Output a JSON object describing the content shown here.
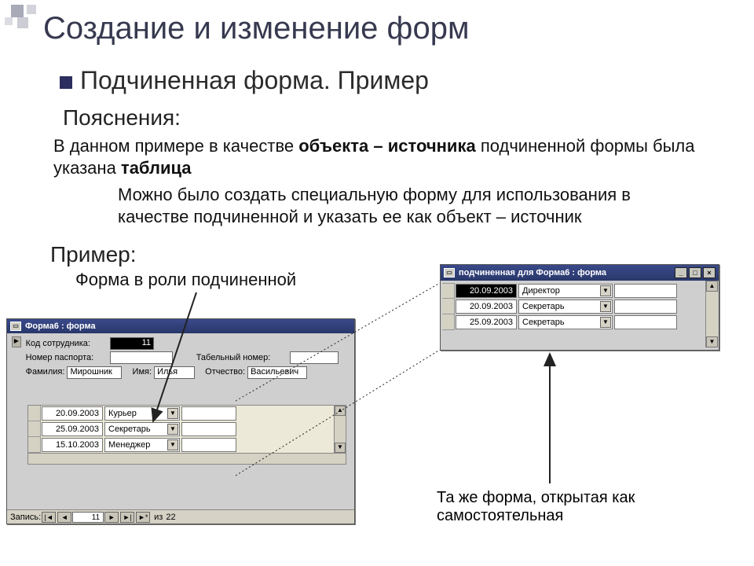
{
  "slide": {
    "title": "Создание и изменение форм",
    "subtitle": "Подчиненная форма. Пример",
    "expl_head": "Пояснения:",
    "para1_a": "В данном примере в качестве ",
    "para1_b": "объекта – источника",
    "para1_c": " подчиненной формы была указана ",
    "para1_d": "таблица",
    "para2": "Можно было создать специальную форму для использования в качестве подчиненной и указать ее как объект – источник",
    "example_head": "Пример:",
    "caption_role": "Форма в роли подчиненной",
    "caption_same": "Та же форма, открытая как самостоятельная"
  },
  "window_main": {
    "title": "Форма6 : форма",
    "labels": {
      "code": "Код сотрудника:",
      "passport": "Номер паспорта:",
      "tab": "Табельный номер:",
      "fam": "Фамилия:",
      "name": "Имя:",
      "patr": "Отчество:"
    },
    "values": {
      "code": "11",
      "passport": "",
      "tab": "",
      "fam": "Мирошник",
      "name": "Илья",
      "patr": "Васильевич"
    },
    "rows": [
      {
        "date": "20.09.2003",
        "job": "Курьер"
      },
      {
        "date": "25.09.2003",
        "job": "Секретарь"
      },
      {
        "date": "15.10.2003",
        "job": "Менеджер"
      }
    ],
    "nav": {
      "record_label": "Запись:",
      "current": "11",
      "of": "из",
      "total": "22"
    }
  },
  "window_sub": {
    "title": "подчиненная для Форма6 : форма",
    "rows": [
      {
        "date": "20.09.2003",
        "job": "Директор"
      },
      {
        "date": "20.09.2003",
        "job": "Секретарь"
      },
      {
        "date": "25.09.2003",
        "job": "Секретарь"
      }
    ]
  },
  "glyphs": {
    "first": "|◄",
    "prev": "◄",
    "next": "►",
    "last": "►|",
    "new": "►*",
    "min": "_",
    "max": "□",
    "close": "×",
    "up": "▲",
    "down": "▼"
  }
}
